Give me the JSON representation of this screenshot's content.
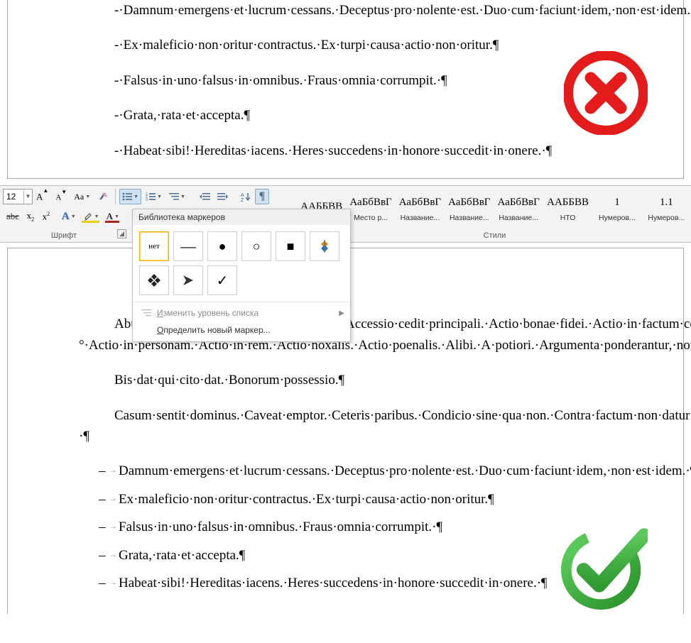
{
  "doc_top": {
    "paragraphs": [
      "-·Damnum·emergens·et·lucrum·cessans.·Deceptus·pro·nolente·est.·Duo·cum·faciunt·idem,·non·est·idem.·¶",
      "-·Ex·maleficio·non·oritur·contractus.·Ex·turpi·causa·actio·non·oritur.¶",
      "-·Falsus·in·uno·falsus·in·omnibus.·Fraus·omnia·corrumpit.·¶",
      "-·Grata,·rata·et·accepta.¶",
      "-·Habeat·sibi!·Hereditas·iacens.·Heres·succedens·in·honore·succedit·in·onere.·¶"
    ]
  },
  "ribbon": {
    "font_size": "12",
    "section_font": "Шрифт",
    "section_styles": "Стили",
    "styles": [
      {
        "preview": "ААББВВ",
        "name": ""
      },
      {
        "preview": "АаБбВвГ",
        "name": "Место р..."
      },
      {
        "preview": "АаБбВвГ",
        "name": "Название..."
      },
      {
        "preview": "АаБбВвГ",
        "name": "Название..."
      },
      {
        "preview": "АаБбВвГ",
        "name": "Название..."
      },
      {
        "preview": "ААББВВ",
        "name": "НТО"
      },
      {
        "preview": "1",
        "name": "Нумеров..."
      },
      {
        "preview": "1.1",
        "name": "Нумеров..."
      }
    ]
  },
  "bullet_dropdown": {
    "title": "Библиотека маркеров",
    "none_label": "нет",
    "change_level": "Изменить уровень списка",
    "change_level_key": "И",
    "define_new": "Определить новый маркер...",
    "define_new_key": "О"
  },
  "doc_bottom": {
    "body": [
      "Abusus·non·tollit·usum.·Accepto·damno.·Accessio·cedit·principali.·Actio·bonae·fidei.·Actio·in·factum·concepta.·Actio·in·ius·concepta.°·Actio·in·personam.·Actio·in·rem.·Actio·noxalis.·Actio·poenalis.·Alibi.·A·potiori.·Argumenta·ponderantur,·non·numerantur.·Argumentum·ad·oculos.¶",
      "Bis·dat·qui·cito·dat.·Bonorum·possessio.¶",
      "Casum·sentit·dominus.·Caveat·emptor.·Ceteris·paribus.·Condicio·sine·qua·non.·Contra·factum·non·datur·argumentum.·Conventio·facit·legam.·Corpus·delicti.·Crescente·malitia·crescere·debet·et·poena.·Cuius·commodum,·eius·debet·esse·incommodum.·Cuius·commodum,·eius·periculum.·Curia·advisare·vult!·¶"
    ],
    "list": [
      "Damnum·emergens·et·lucrum·cessans.·Deceptus·pro·nolente·est.·Duo·cum·faciunt·idem,·non·est·idem.·¶",
      "Ex·maleficio·non·oritur·contractus.·Ex·turpi·causa·actio·non·oritur.¶",
      "Falsus·in·uno·falsus·in·omnibus.·Fraus·omnia·corrumpit.·¶",
      "Grata,·rata·et·accepta.¶",
      "Habeat·sibi!·Hereditas·iacens.·Heres·succedens·in·honore·succedit·in·onere.·¶"
    ]
  },
  "badges": {
    "wrong": "wrong",
    "right": "right"
  }
}
